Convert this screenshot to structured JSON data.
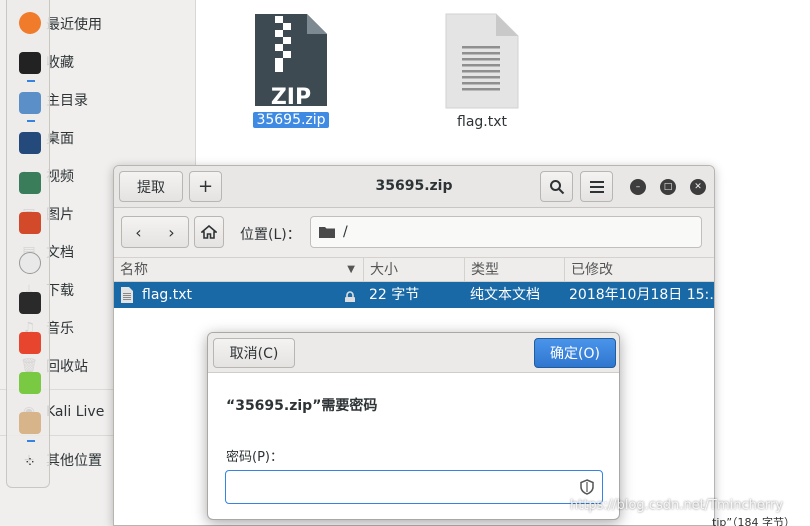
{
  "sidebar": {
    "items": [
      {
        "label": "最近使用",
        "icon": "clock-icon"
      },
      {
        "label": "收藏",
        "icon": "star-icon"
      },
      {
        "label": "主目录",
        "icon": "home-icon"
      },
      {
        "label": "桌面",
        "icon": "desktop-icon"
      },
      {
        "label": "视频",
        "icon": "video-icon"
      },
      {
        "label": "图片",
        "icon": "image-icon"
      },
      {
        "label": "文档",
        "icon": "document-icon"
      },
      {
        "label": "下载",
        "icon": "download-icon"
      },
      {
        "label": "音乐",
        "icon": "music-icon"
      },
      {
        "label": "回收站",
        "icon": "trash-icon"
      },
      {
        "label": "Kali Live",
        "icon": "disc-icon"
      },
      {
        "label": "其他位置",
        "icon": "plus-icon"
      }
    ]
  },
  "desktop_files": [
    {
      "name": "35695.zip",
      "icon": "zip-file-icon",
      "badge": "ZIP",
      "selected": true
    },
    {
      "name": "flag.txt",
      "icon": "text-file-icon",
      "selected": false
    }
  ],
  "archive_window": {
    "title": "35695.zip",
    "extract_label": "提取",
    "add_icon": "plus-icon",
    "search_icon": "search-icon",
    "menu_icon": "hamburger-menu-icon",
    "location_label": "位置(L)：",
    "location_path": "/",
    "columns": [
      "名称",
      "大小",
      "类型",
      "已修改"
    ],
    "rows": [
      {
        "name": "flag.txt",
        "size": "22 字节",
        "type": "纯文本文档",
        "modified": "2018年10月18日 15:…",
        "locked": true
      }
    ]
  },
  "password_dialog": {
    "cancel_label": "取消(C)",
    "ok_label": "确定(O)",
    "message": "“35695.zip”需要密码",
    "password_label": "密码(P)：",
    "password_value": ""
  },
  "status_fragment": "tip”（184 字节）",
  "watermark": "https://blog.csdn.net/Tmincherry",
  "colors": {
    "accent": "#3584e4",
    "selected_row": "#1a69a7",
    "file_selection": "#3f8ae2"
  }
}
